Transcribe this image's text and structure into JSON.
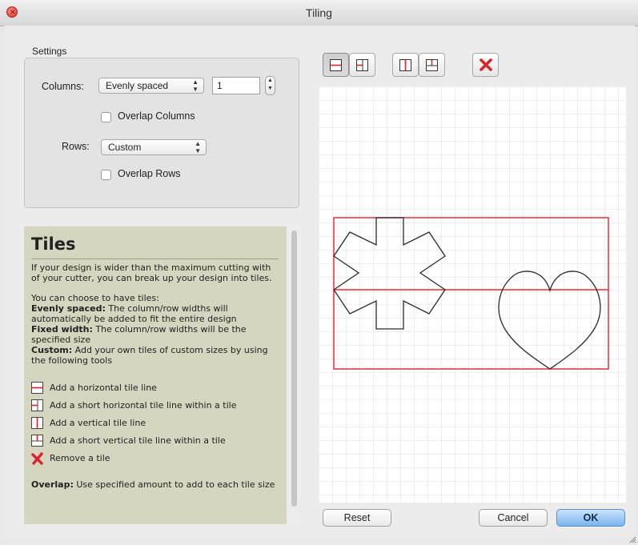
{
  "window": {
    "title": "Tiling"
  },
  "settings": {
    "caption": "Settings",
    "columns_label": "Columns:",
    "columns_mode": "Evenly spaced",
    "columns_count": "1",
    "overlap_columns_label": "Overlap Columns",
    "overlap_columns_checked": false,
    "rows_label": "Rows:",
    "rows_mode": "Custom",
    "overlap_rows_label": "Overlap Rows",
    "overlap_rows_checked": false
  },
  "help": {
    "title": "Tiles",
    "intro": "If your design is wider than the maximum cutting with of your cutter, you can break up your design into tiles.",
    "choose_heading": "You can choose to have tiles:",
    "options": [
      {
        "term": "Evenly spaced:",
        "text": " The column/row widths will automatically be added to fit the entire design"
      },
      {
        "term": "Fixed width:",
        "text": " The column/row widths will be the specified size"
      },
      {
        "term": "Custom:",
        "text": " Add your own tiles of custom sizes by using the following tools"
      }
    ],
    "tools": [
      {
        "icon": "horizontal-tile-line-icon",
        "label": "Add a horizontal tile line"
      },
      {
        "icon": "short-horizontal-tile-line-icon",
        "label": "Add a short horizontal tile line within a tile"
      },
      {
        "icon": "vertical-tile-line-icon",
        "label": "Add a vertical tile line"
      },
      {
        "icon": "short-vertical-tile-line-icon",
        "label": "Add a short vertical tile line within a tile"
      },
      {
        "icon": "remove-tile-icon",
        "label": "Remove a tile"
      }
    ],
    "overlap_term": "Overlap:",
    "overlap_text": " Use specified amount to add to each tile size"
  },
  "toolbar": {
    "buttons": [
      {
        "name": "horizontal-tile-line",
        "icon": "horizontal-tile-line-icon",
        "active": true
      },
      {
        "name": "short-horizontal-tile-line",
        "icon": "short-horizontal-tile-line-icon",
        "active": false
      },
      {
        "name": "vertical-tile-line",
        "icon": "vertical-tile-line-icon",
        "active": false
      },
      {
        "name": "short-vertical-tile-line",
        "icon": "short-vertical-tile-line-icon",
        "active": false
      },
      {
        "name": "remove-tile",
        "icon": "remove-tile-icon",
        "active": false
      }
    ]
  },
  "canvas": {
    "shapes": [
      "asterisk-shape",
      "heart-shape"
    ],
    "tile_color": "#e0303a"
  },
  "buttons": {
    "reset": "Reset",
    "cancel": "Cancel",
    "ok": "OK"
  },
  "colors": {
    "help_background": "#d6d6c0",
    "tile_line": "#e0303a",
    "ok_button": "#79b4ef",
    "remove_icon": "#d8262c"
  }
}
